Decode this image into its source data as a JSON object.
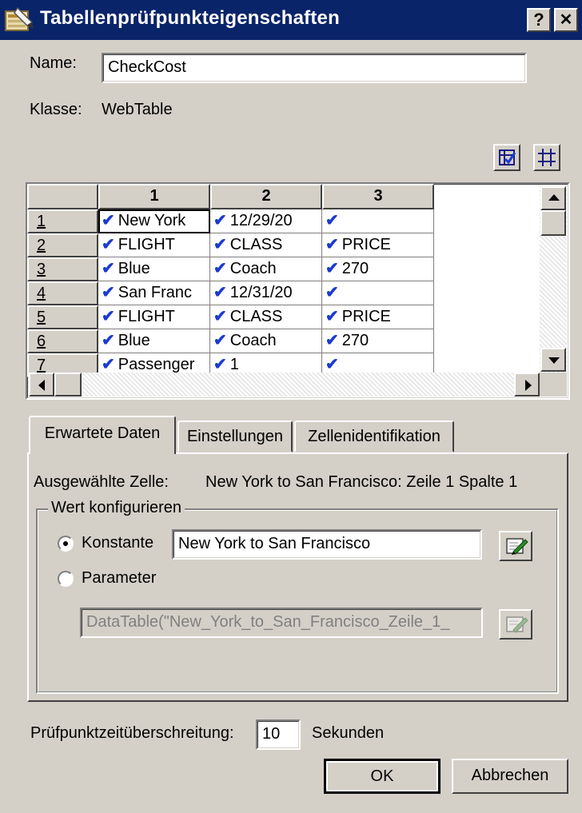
{
  "window": {
    "title": "Tabellenprüfpunkteigenschaften",
    "help_label": "?",
    "close_label": "✕"
  },
  "form": {
    "name_label": "Name:",
    "name_value": "CheckCost",
    "class_label": "Klasse:",
    "class_value": "WebTable"
  },
  "grid": {
    "columns": [
      "1",
      "2",
      "3"
    ],
    "rows": [
      {
        "num": "1",
        "cells": [
          "New York",
          "12/29/20",
          ""
        ]
      },
      {
        "num": "2",
        "cells": [
          "FLIGHT",
          "CLASS",
          "PRICE"
        ]
      },
      {
        "num": "3",
        "cells": [
          "Blue",
          "Coach",
          "270"
        ]
      },
      {
        "num": "4",
        "cells": [
          "San Franc",
          "12/31/20",
          ""
        ]
      },
      {
        "num": "5",
        "cells": [
          "FLIGHT",
          "CLASS",
          "PRICE"
        ]
      },
      {
        "num": "6",
        "cells": [
          "Blue",
          "Coach",
          "270"
        ]
      },
      {
        "num": "7",
        "cells": [
          "Passenger",
          "1",
          ""
        ]
      }
    ],
    "check_glyph": "✔"
  },
  "tabs": [
    {
      "label": "Erwartete Daten",
      "active": true
    },
    {
      "label": "Einstellungen",
      "active": false
    },
    {
      "label": "Zellenidentifikation",
      "active": false
    }
  ],
  "panel": {
    "selected_cell_label": "Ausgewählte Zelle:",
    "selected_cell_value": "New York to San Francisco: Zeile 1 Spalte 1",
    "group_title": "Wert konfigurieren",
    "constant_label": "Konstante",
    "constant_value": "New York to San Francisco",
    "parameter_label": "Parameter",
    "parameter_value": "DataTable(\"New_York_to_San_Francisco_Zeile_1_",
    "selected_option": "Konstante"
  },
  "footer": {
    "timeout_label": "Prüfpunktzeitüberschreitung:",
    "timeout_value": "10",
    "timeout_unit": "Sekunden",
    "ok_label": "OK",
    "cancel_label": "Abbrechen"
  },
  "colors": {
    "titlebar": "#0a246a",
    "face": "#d4d0c8",
    "check": "#1a3cd0"
  }
}
